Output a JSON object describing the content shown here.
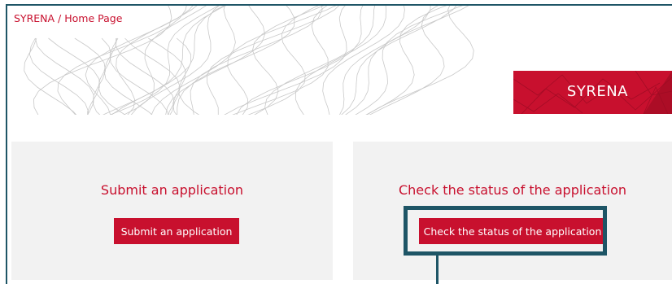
{
  "breadcrumb": {
    "app": "SYRENA",
    "separator": " / ",
    "page": "Home Page"
  },
  "brand": {
    "label": "SYRENA"
  },
  "cards": [
    {
      "title": "Submit an application",
      "button_label": "Submit an application"
    },
    {
      "title": "Check the status of the application",
      "button_label": "Check the status of the application"
    }
  ],
  "colors": {
    "accent": "#c8102e",
    "highlight": "#1e5566",
    "card_bg": "#f2f2f2"
  }
}
